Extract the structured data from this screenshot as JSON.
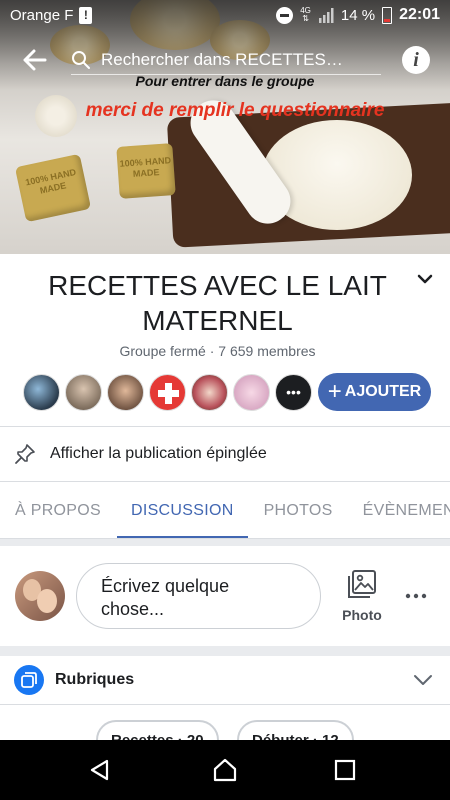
{
  "status_bar": {
    "carrier": "Orange F",
    "network": "4G",
    "battery": "14 %",
    "time": "22:01"
  },
  "header": {
    "search_placeholder": "Rechercher dans RECETTES…"
  },
  "cover": {
    "line1": "Pour entrer dans le groupe",
    "line2": "merci de remplir le questionnaire",
    "soap_text": "100% HAND MADE"
  },
  "group": {
    "name": "RECETTES AVEC LE LAIT MATERNEL",
    "meta": "Groupe fermé · 7 659 membres",
    "add_label": "AJOUTER",
    "more_members": "•••"
  },
  "pinned": {
    "label": "Afficher la publication épinglée"
  },
  "tabs": [
    {
      "label": "À PROPOS"
    },
    {
      "label": "DISCUSSION"
    },
    {
      "label": "PHOTOS"
    },
    {
      "label": "ÉVÈNEMENTS"
    }
  ],
  "composer": {
    "placeholder": "Écrivez quelque chose...",
    "photo_label": "Photo"
  },
  "rubriques": {
    "label": "Rubriques",
    "chips": [
      "Recettes · 20",
      "Débuter · 12"
    ]
  },
  "colors": {
    "accent": "#4267b2",
    "cover_red": "#e53320"
  }
}
